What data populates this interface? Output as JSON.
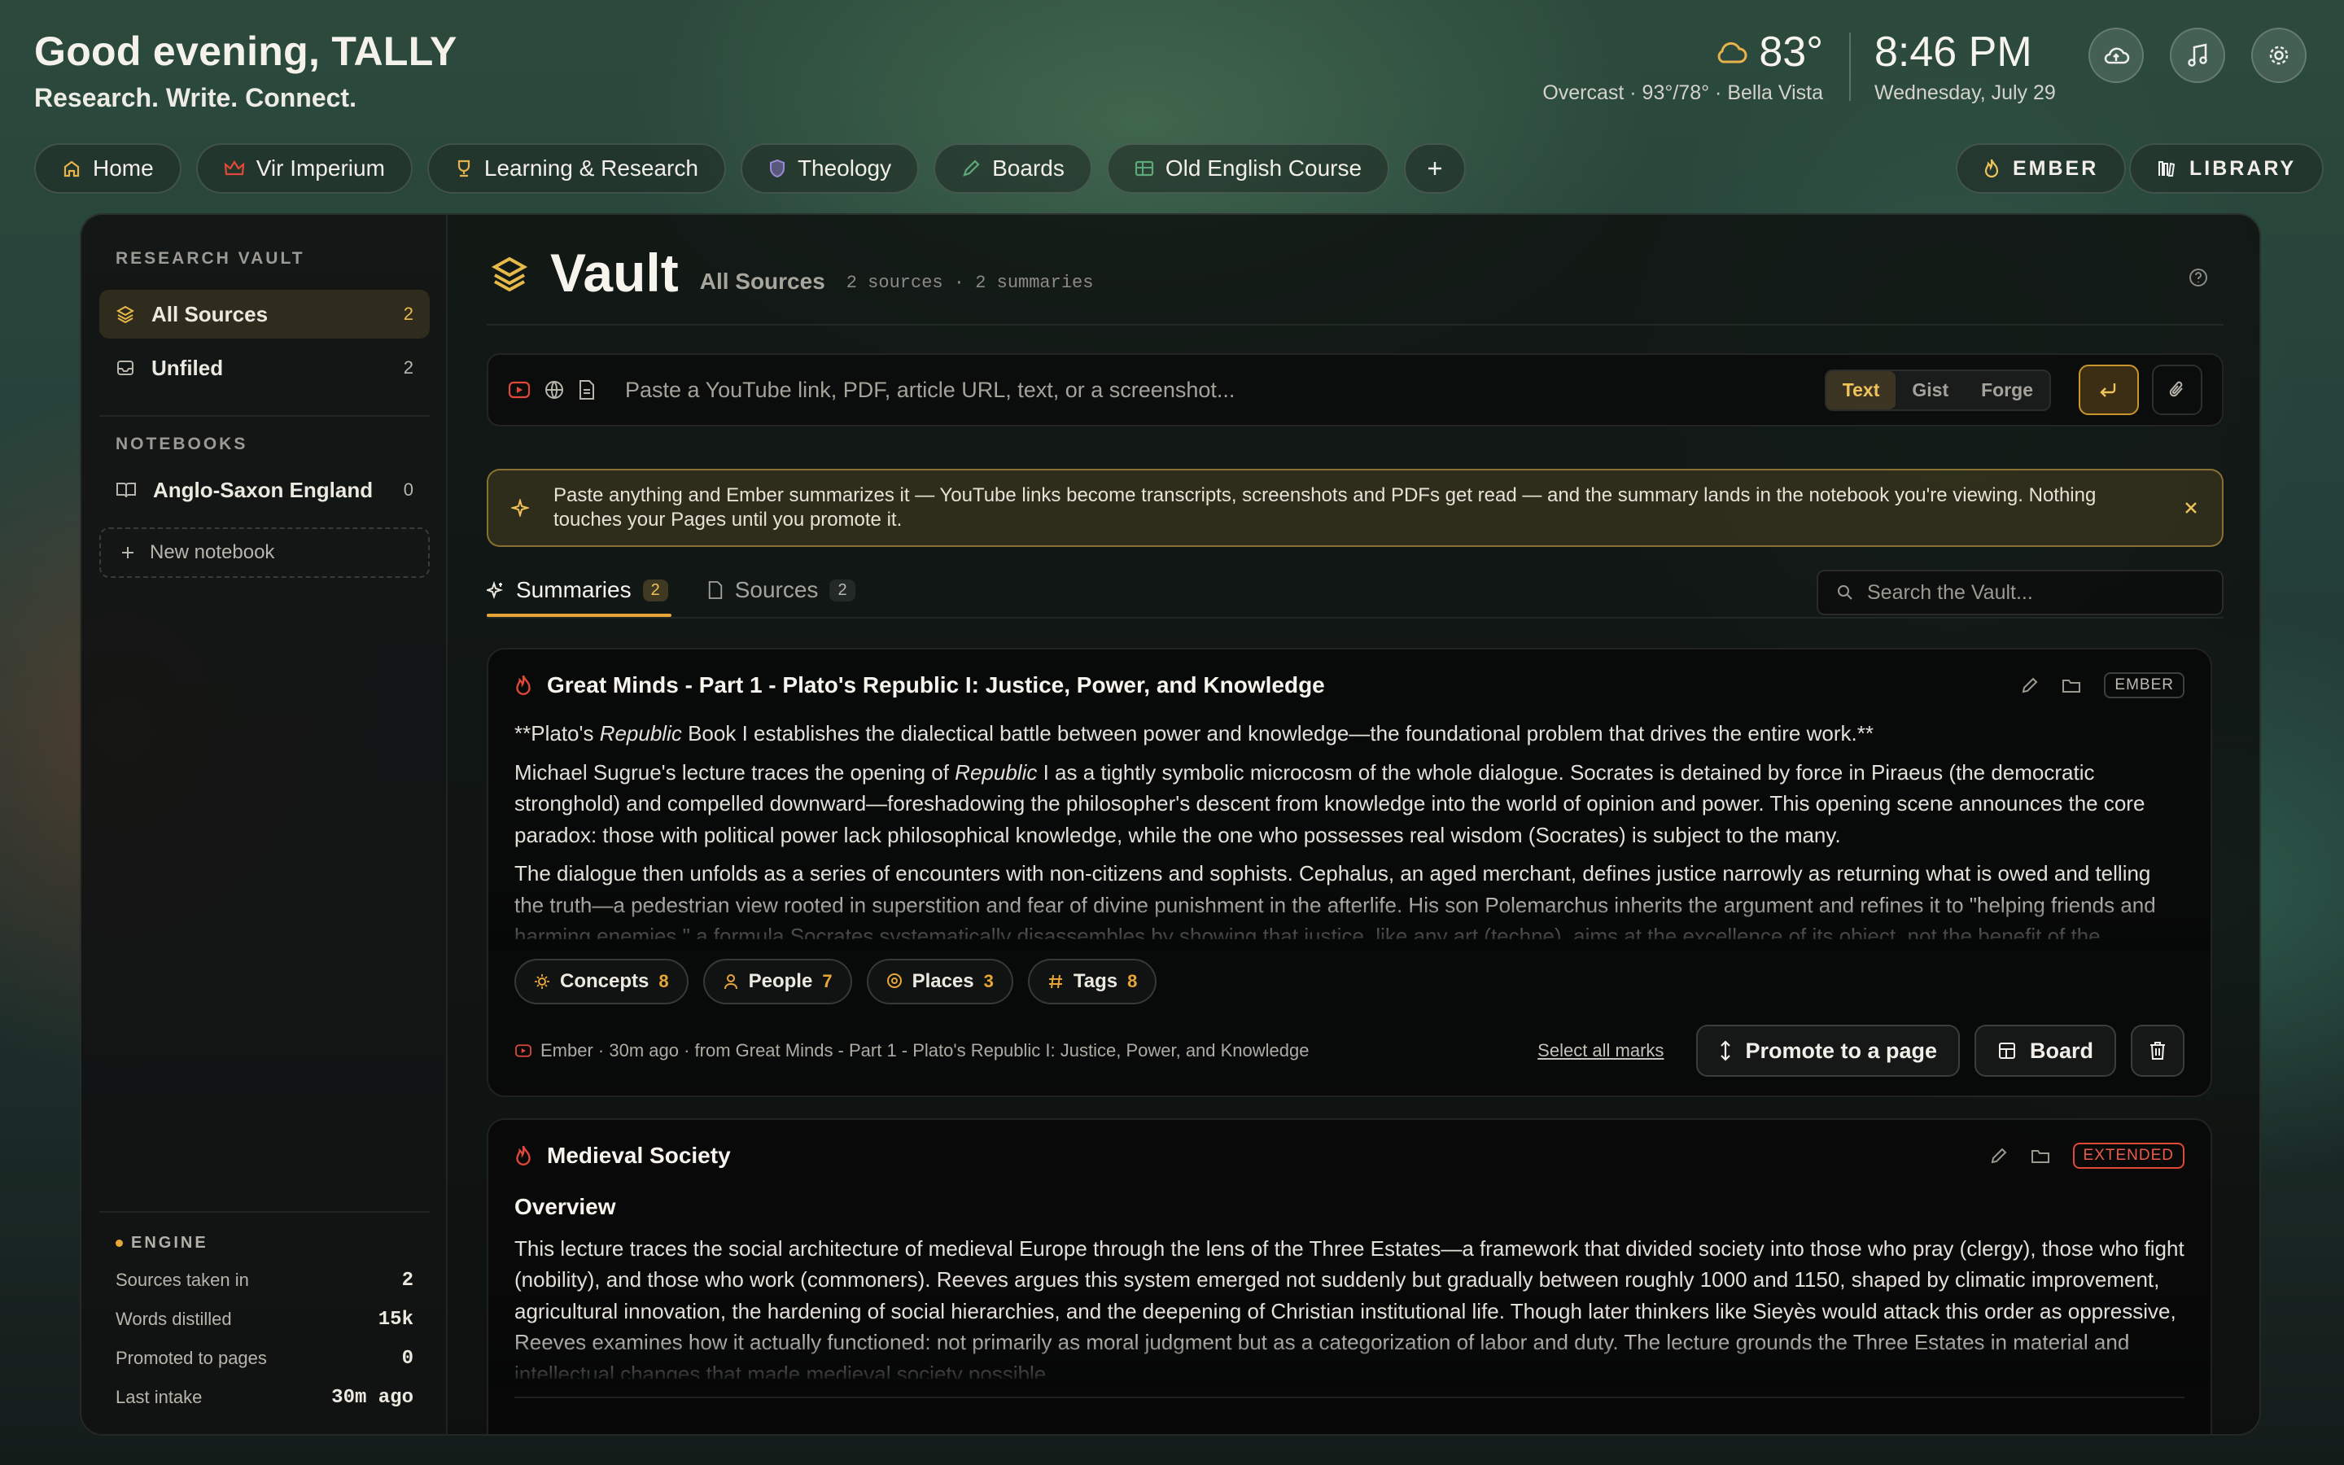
{
  "header": {
    "greeting": "Good evening, TALLY",
    "tagline": "Research. Write. Connect.",
    "weather": {
      "temp": "83°",
      "detail": "Overcast · 93°/78° · Bella Vista",
      "icon": "cloud-sun-icon"
    },
    "clock": {
      "time": "8:46 PM",
      "date": "Wednesday, July 29"
    },
    "buttons": [
      "cloud-sync-icon",
      "music-icon",
      "gear-icon"
    ]
  },
  "tabs": [
    {
      "label": "Home",
      "icon": "home-icon"
    },
    {
      "label": "Vir Imperium",
      "icon": "crown-icon"
    },
    {
      "label": "Learning & Research",
      "icon": "trophy-icon"
    },
    {
      "label": "Theology",
      "icon": "shield-icon"
    },
    {
      "label": "Boards",
      "icon": "pencil-icon"
    },
    {
      "label": "Old English Course",
      "icon": "table-icon"
    }
  ],
  "right_buttons": {
    "ember": "EMBER",
    "library": "LIBRARY"
  },
  "sidebar": {
    "research_title": "RESEARCH VAULT",
    "items": [
      {
        "label": "All Sources",
        "count": "2"
      },
      {
        "label": "Unfiled",
        "count": "2"
      }
    ],
    "notebooks_title": "NOTEBOOKS",
    "notebooks": [
      {
        "label": "Anglo-Saxon England",
        "count": "0"
      }
    ],
    "new_notebook": "New notebook",
    "engine": {
      "title": "ENGINE",
      "stats": [
        {
          "label": "Sources taken in",
          "value": "2"
        },
        {
          "label": "Words distilled",
          "value": "15k"
        },
        {
          "label": "Promoted to pages",
          "value": "0"
        },
        {
          "label": "Last intake",
          "value": "30m ago"
        }
      ]
    }
  },
  "main": {
    "title": "Vault",
    "subtitle": "All Sources",
    "meta": "2 sources · 2 summaries",
    "input_placeholder": "Paste a YouTube link, PDF, article URL, text, or a screenshot...",
    "modes": [
      "Text",
      "Gist",
      "Forge"
    ],
    "active_mode": "Text",
    "notice": "Paste anything and Ember summarizes it — YouTube links become transcripts, screenshots and PDFs get read — and the summary lands in the notebook you're viewing. Nothing touches your Pages until you promote it.",
    "subtabs": [
      {
        "label": "Summaries",
        "count": "2"
      },
      {
        "label": "Sources",
        "count": "2"
      }
    ],
    "search_placeholder": "Search the Vault..."
  },
  "cards": [
    {
      "title": "Great Minds - Part 1 - Plato's Republic I: Justice, Power, and Knowledge",
      "badge": "EMBER",
      "p1_a": "**Plato's ",
      "p1_em": "Republic",
      "p1_b": " Book I establishes the dialectical battle between power and knowledge—the foundational problem that drives the entire work.**",
      "p2_a": "Michael Sugrue's lecture traces the opening of ",
      "p2_em": "Republic",
      "p2_b": " I as a tightly symbolic microcosm of the whole dialogue. Socrates is detained by force in Piraeus (the democratic stronghold) and compelled downward—foreshadowing the philosopher's descent from knowledge into the world of opinion and power. This opening scene announces the core paradox: those with political power lack philosophical knowledge, while the one who possesses real wisdom (Socrates) is subject to the many.",
      "p3": "The dialogue then unfolds as a series of encounters with non-citizens and sophists. Cephalus, an aged merchant, defines justice narrowly as returning what is owed and telling the truth—a pedestrian view rooted in superstition and fear of divine punishment in the afterlife. His son Polemarchus inherits the argument and refines it to \"helping friends and harming enemies,\" a formula Socrates systematically disassembles by showing that justice, like any art (techne), aims at the excellence of its object, not the benefit of the",
      "chips": [
        {
          "label": "Concepts",
          "count": "8",
          "icon": "bulb-icon"
        },
        {
          "label": "People",
          "count": "7",
          "icon": "person-icon"
        },
        {
          "label": "Places",
          "count": "3",
          "icon": "pin-icon"
        },
        {
          "label": "Tags",
          "count": "8",
          "icon": "hash-icon"
        }
      ],
      "footer_meta": "Ember · 30m ago · from Great Minds - Part 1 - Plato's Republic I: Justice, Power, and Knowledge",
      "select_all": "Select all marks",
      "promote": "Promote to a page",
      "board": "Board"
    },
    {
      "title": "Medieval Society",
      "badge": "EXTENDED",
      "heading": "Overview",
      "body": "This lecture traces the social architecture of medieval Europe through the lens of the Three Estates—a framework that divided society into those who pray (clergy), those who fight (nobility), and those who work (commoners). Reeves argues this system emerged not suddenly but gradually between roughly 1000 and 1150, shaped by climatic improvement, agricultural innovation, the hardening of social hierarchies, and the deepening of Christian institutional life. Though later thinkers like Sieyès would attack this order as oppressive, Reeves examines how it actually functioned: not primarily as moral judgment but as a categorization of labor and duty. The lecture grounds the Three Estates in material and intellectual changes that made medieval society possible."
    }
  ],
  "colors": {
    "accent": "#e7a638",
    "ember_red": "#e0483a"
  }
}
